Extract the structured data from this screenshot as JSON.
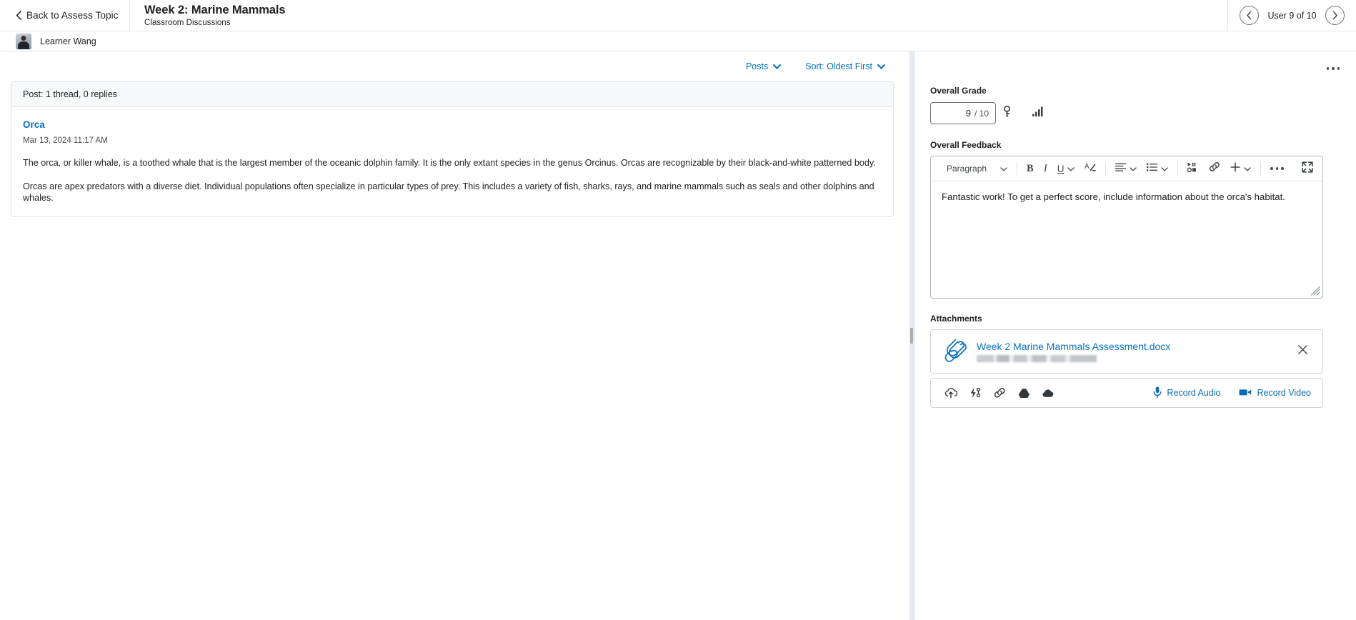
{
  "header": {
    "back_label": "Back to Assess Topic",
    "title": "Week 2: Marine Mammals",
    "subtitle": "Classroom Discussions",
    "user_nav": {
      "prev_icon": "chevron-left-icon",
      "next_icon": "chevron-right-icon",
      "counter": "User 9 of 10"
    }
  },
  "learner": {
    "name": "Learner Wang",
    "avatar_alt": "avatar"
  },
  "left_pane": {
    "controls": [
      {
        "label": "Posts",
        "icon": "chevron-down-icon"
      },
      {
        "label": "Sort: Oldest First",
        "icon": "chevron-down-icon"
      }
    ],
    "thread_summary": "Post: 1 thread, 0 replies",
    "post": {
      "title": "Orca",
      "date": "Mar 13, 2024 11:17 AM",
      "paragraph1": "The orca, or killer whale, is a toothed whale that is the largest member of the oceanic dolphin family. It is the only extant species in the genus Orcinus. Orcas are recognizable by their black-and-white patterned body.",
      "paragraph2": "Orcas are apex predators with a diverse diet. Individual populations often specialize in particular types of prey. This includes a variety of fish, sharks, rays, and marine mammals such as seals and other dolphins and whales."
    }
  },
  "right_pane": {
    "menu_icon": "more-options-icon",
    "grade": {
      "label": "Overall Grade",
      "value": "9",
      "denominator": "/ 10",
      "rubric_icon": "key-icon",
      "statistics_icon": "bar-chart-icon"
    },
    "feedback": {
      "label": "Overall Feedback",
      "text": "Fantastic work! To get a perfect score, include information about the orca's habitat.",
      "toolbar": {
        "block_format": "Paragraph",
        "block_format_icon": "chevron-down-icon",
        "bold": "B",
        "italic": "I",
        "underline": "U",
        "underline_more_icon": "chevron-down-icon",
        "text_color_icon": "text-color-icon",
        "align_icon": "align-left-icon",
        "align_more_icon": "chevron-down-icon",
        "list_icon": "bulleted-list-icon",
        "list_more_icon": "chevron-down-icon",
        "media_icon": "insert-media-icon",
        "link_icon": "insert-link-icon",
        "insert_icon": "plus-icon",
        "insert_more_icon": "chevron-down-icon",
        "more_icon": "more-options-icon",
        "fullscreen_icon": "fullscreen-icon"
      },
      "resize_icon": "resize-handle-icon"
    },
    "attachments": {
      "label": "Attachments",
      "items": [
        {
          "name": "Week 2 Marine Mammals Assessment.docx",
          "meta": "",
          "file_icon": "paperclip-icon",
          "remove_icon": "close-icon"
        }
      ],
      "actions": {
        "icons": [
          "upload-icon",
          "quicklink-icon",
          "link-icon",
          "google-drive-icon",
          "onedrive-icon"
        ],
        "record_audio": "Record Audio",
        "record_audio_icon": "microphone-icon",
        "record_video": "Record Video",
        "record_video_icon": "video-camera-icon"
      }
    }
  },
  "splitter": {
    "icon": "resize-splitter-icon"
  },
  "colors": {
    "link": "#006fbf",
    "accent": "#0a6cb8",
    "text": "#202122",
    "border": "#e3e6e8",
    "panel_header_bg": "#f7f9fb",
    "splitter": "#e3eaf2"
  }
}
